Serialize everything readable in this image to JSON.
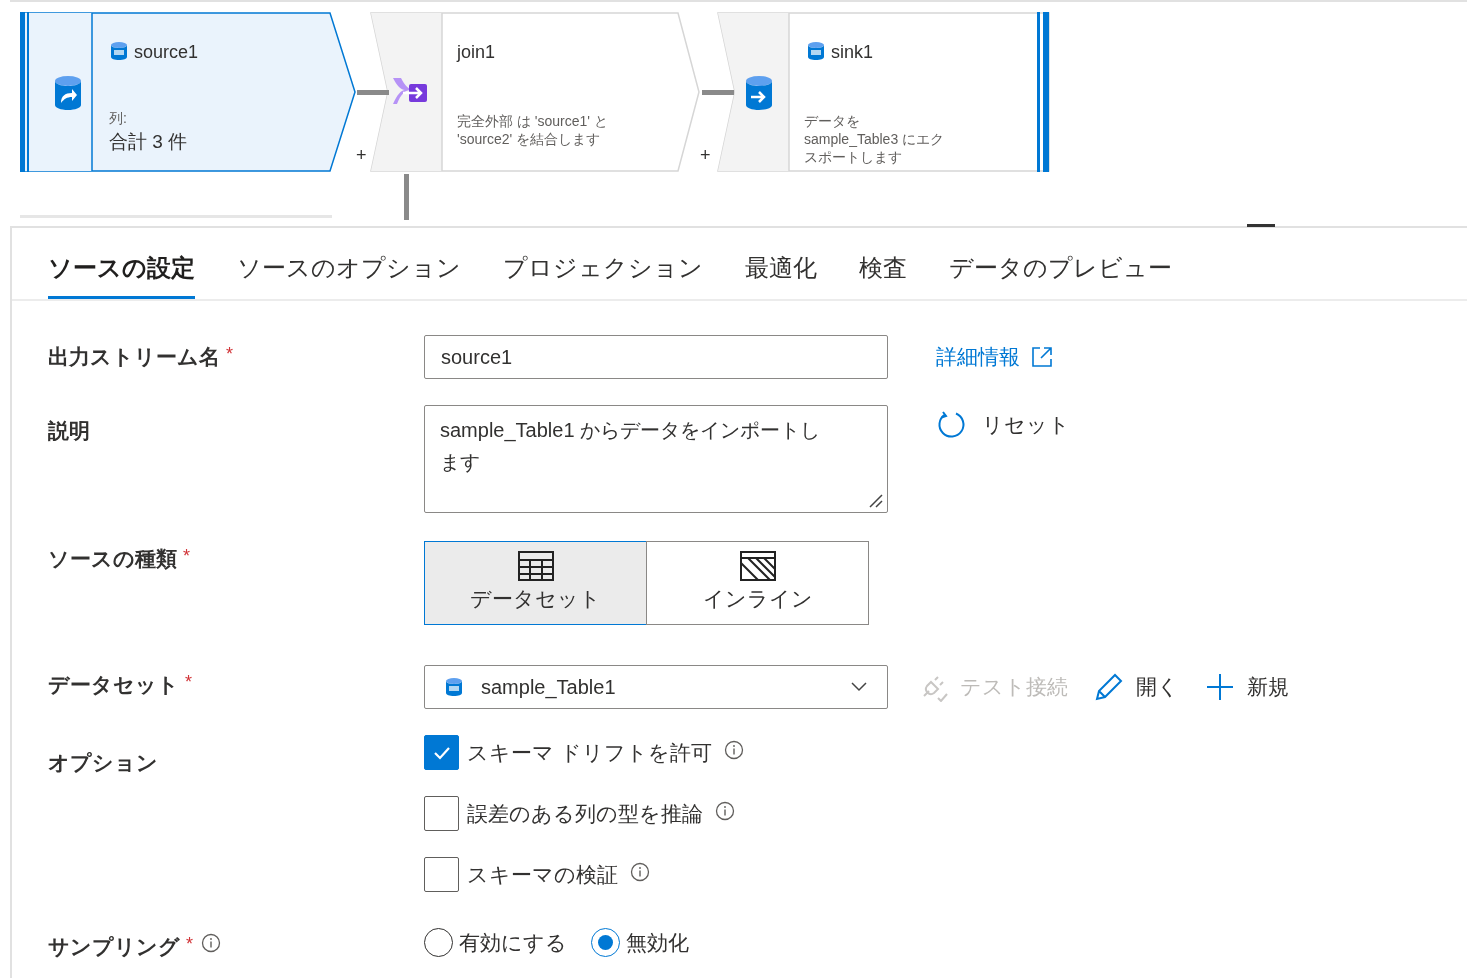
{
  "flow": {
    "nodes": [
      {
        "kind": "source",
        "title": "source1",
        "selected": true,
        "caption": "列:",
        "detail": "合計 3 件",
        "add": "+"
      },
      {
        "kind": "join",
        "title": "join1",
        "selected": false,
        "description": "完全外部 は 'source1' と 'source2' を結合します",
        "add": "+"
      },
      {
        "kind": "sink",
        "title": "sink1",
        "selected": false,
        "description": "データを sample_Table3 にエクスポートします"
      }
    ]
  },
  "tabs": [
    {
      "label": "ソースの設定",
      "selected": true
    },
    {
      "label": "ソースのオプション",
      "selected": false
    },
    {
      "label": "プロジェクション",
      "selected": false
    },
    {
      "label": "最適化",
      "selected": false
    },
    {
      "label": "検査",
      "selected": false
    },
    {
      "label": "データのプレビュー",
      "selected": false
    }
  ],
  "form": {
    "output_stream": {
      "label": "出力ストリーム名",
      "required_mark": "*",
      "value": "source1",
      "link": "詳細情報"
    },
    "description": {
      "label": "説明",
      "value": "sample_Table1 からデータをインポートします",
      "reset": "リセット"
    },
    "source_type": {
      "label": "ソースの種類",
      "required_mark": "*",
      "options": [
        {
          "kind": "dataset",
          "label": "データセット",
          "selected": true
        },
        {
          "kind": "inline",
          "label": "インライン",
          "selected": false
        }
      ]
    },
    "dataset": {
      "label": "データセット",
      "required_mark": "*",
      "value": "sample_Table1",
      "actions": [
        {
          "kind": "test",
          "label": "テスト接続",
          "disabled": true
        },
        {
          "kind": "open",
          "label": "開く",
          "disabled": false
        },
        {
          "kind": "new",
          "label": "新規",
          "disabled": false
        }
      ]
    },
    "options": {
      "label": "オプション",
      "checkboxes": [
        {
          "label": "スキーマ ドリフトを許可",
          "checked": true
        },
        {
          "label": "誤差のある列の型を推論",
          "checked": false
        },
        {
          "label": "スキーマの検証",
          "checked": false
        }
      ]
    },
    "sampling": {
      "label": "サンプリング",
      "required_mark": "*",
      "radios": [
        {
          "label": "有効にする",
          "selected": false
        },
        {
          "label": "無効化",
          "selected": true
        }
      ]
    }
  }
}
